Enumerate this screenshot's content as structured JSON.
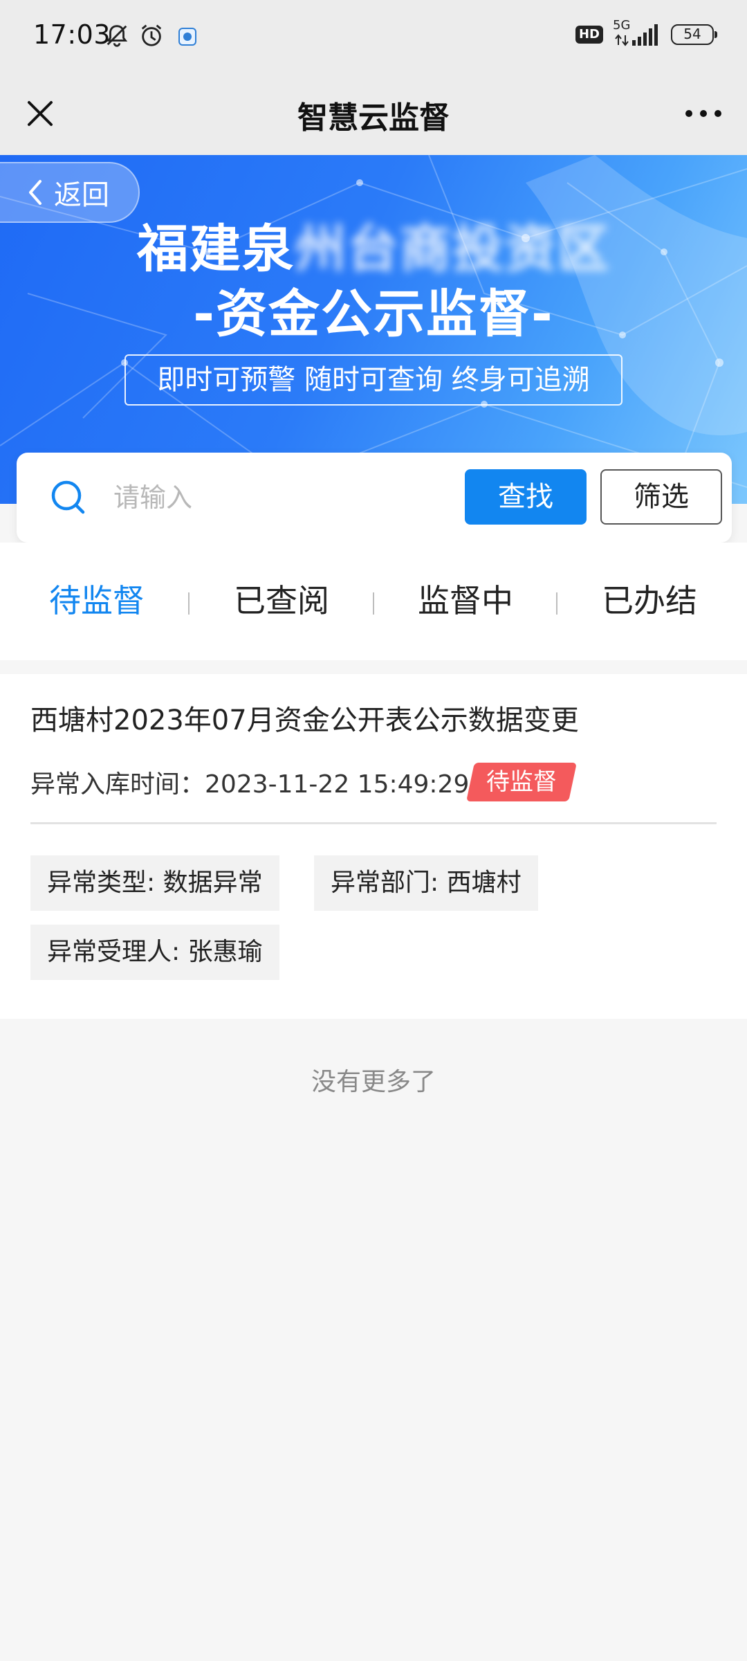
{
  "status_bar": {
    "time": "17:03",
    "icons": [
      "mute-bell-icon",
      "alarm-icon",
      "app-notification-icon"
    ],
    "hd": "HD",
    "network": "5G",
    "battery": "54"
  },
  "title_bar": {
    "title": "智慧云监督",
    "close_icon": "close-icon",
    "more_icon": "more-icon"
  },
  "banner": {
    "back_label": "返回",
    "title_line1_visible": "福建泉",
    "title_line1_obscured": "州台商投资区",
    "title_line2": "-资金公示监督-",
    "slogan": "即时可预警 随时可查询 终身可追溯",
    "colors": {
      "start": "#1f6af5",
      "end": "#7cc7fd"
    }
  },
  "search": {
    "placeholder": "请输入",
    "value": "",
    "find_label": "查找",
    "filter_label": "筛选"
  },
  "tabs": [
    {
      "label": "待监督",
      "active": true
    },
    {
      "label": "已查阅",
      "active": false
    },
    {
      "label": "监督中",
      "active": false
    },
    {
      "label": "已办结",
      "active": false
    }
  ],
  "records": [
    {
      "title": "西塘村2023年07月资金公开表公示数据变更",
      "time_label": "异常入库时间：",
      "time_value": "2023-11-22 15:49:29",
      "status": "待监督",
      "tags": [
        "异常类型: 数据异常",
        "异常部门: 西塘村",
        "异常受理人: 张惠瑜"
      ]
    }
  ],
  "footer": {
    "no_more": "没有更多了"
  },
  "colors": {
    "accent": "#1286f0",
    "badge": "#f45a5c"
  }
}
